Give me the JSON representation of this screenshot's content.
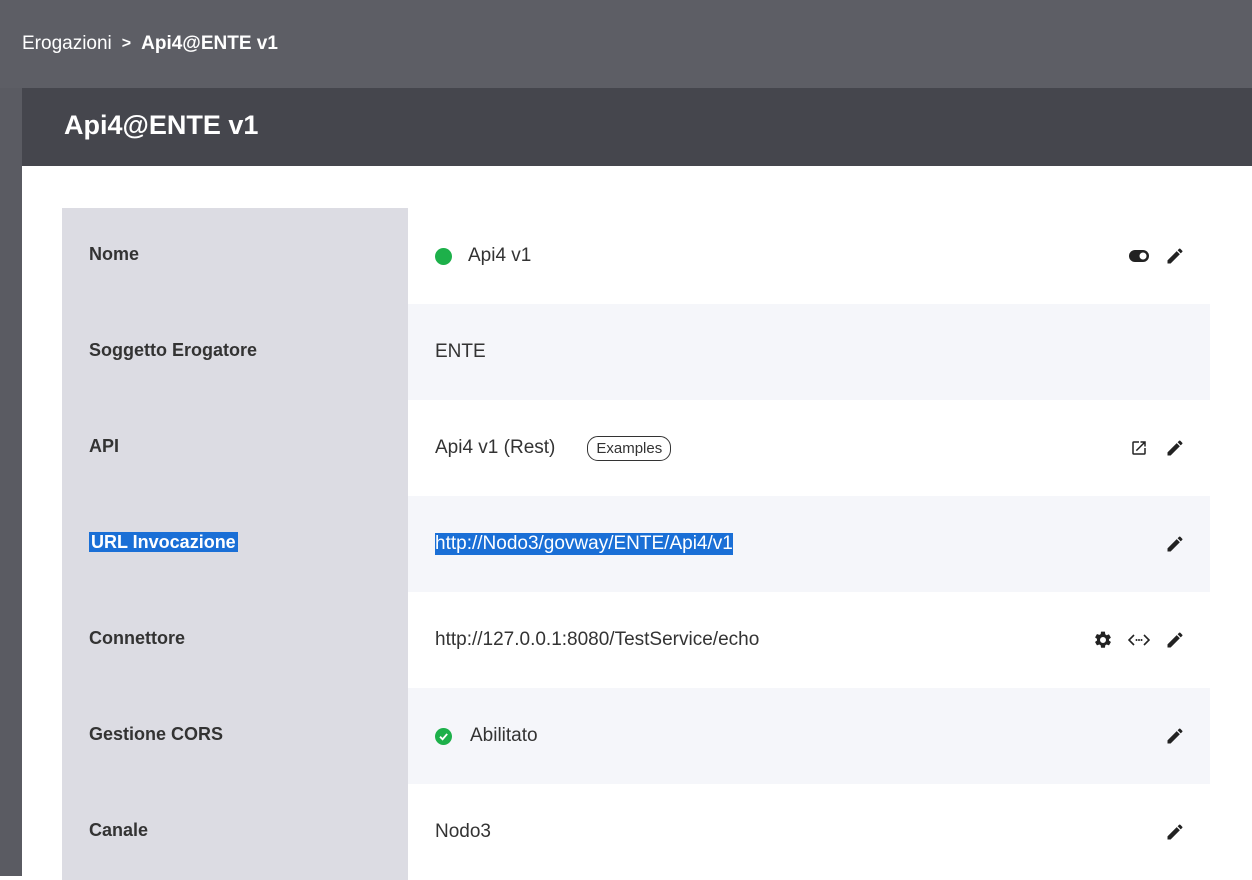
{
  "breadcrumb": {
    "parent": "Erogazioni",
    "separator": ">",
    "current": "Api4@ENTE v1"
  },
  "page_title": "Api4@ENTE v1",
  "rows": [
    {
      "label": "Nome",
      "value": "Api4 v1",
      "status": "active"
    },
    {
      "label": "Soggetto Erogatore",
      "value": "ENTE"
    },
    {
      "label": "API",
      "value": "Api4 v1 (Rest)",
      "tag": "Examples"
    },
    {
      "label": "URL Invocazione",
      "value": "http://Nodo3/govway/ENTE/Api4/v1"
    },
    {
      "label": "Connettore",
      "value": "http://127.0.0.1:8080/TestService/echo"
    },
    {
      "label": "Gestione CORS",
      "value": "Abilitato"
    },
    {
      "label": "Canale",
      "value": "Nodo3"
    }
  ],
  "colors": {
    "accent_selection": "#1a6fd6",
    "status_green": "#1db04a",
    "label_bg": "#dcdce3",
    "title_bar": "#45464d"
  }
}
